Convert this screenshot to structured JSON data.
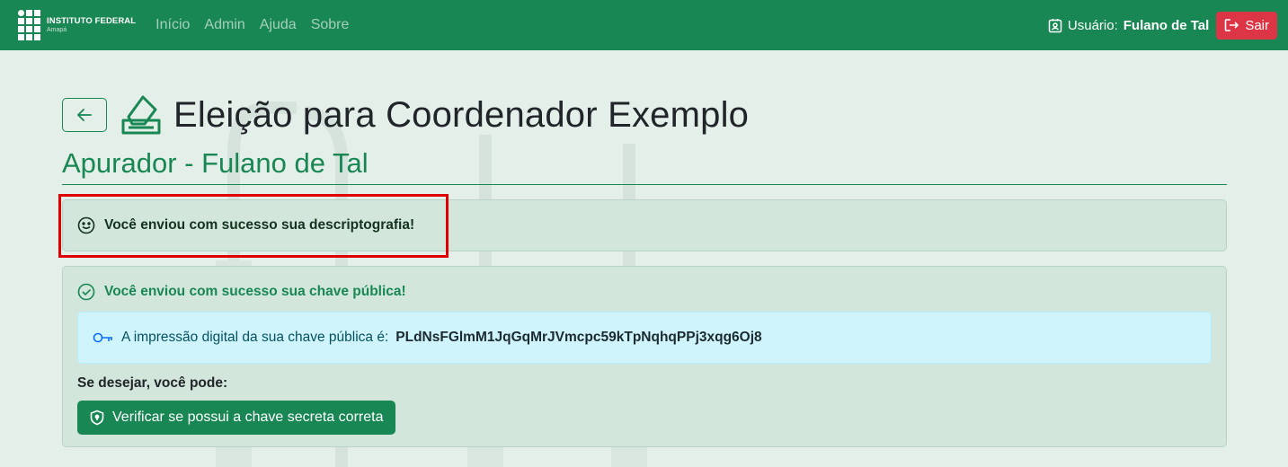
{
  "navbar": {
    "brand_name": "INSTITUTO FEDERAL",
    "brand_sub": "Amapá",
    "links": [
      {
        "label": "Início"
      },
      {
        "label": "Admin"
      },
      {
        "label": "Ajuda"
      },
      {
        "label": "Sobre"
      }
    ],
    "user_label": "Usuário:",
    "user_name": "Fulano de Tal",
    "logout_label": "Sair"
  },
  "page": {
    "title": "Eleição para Coordenador Exemplo",
    "subtitle": "Apurador - Fulano de Tal"
  },
  "decrypt_card": {
    "message": "Você enviou com sucesso sua descriptografia!",
    "icon": "smile-icon"
  },
  "pubkey_card": {
    "title": "Você enviou com sucesso sua chave pública!",
    "fingerprint_label": "A impressão digital da sua chave pública é:",
    "fingerprint_value": "PLdNsFGlmM1JqGqMrJVmcpc59kTpNqhqPPj3xqg6Oj8",
    "prompt": "Se desejar, você pode:",
    "verify_button": "Verificar se possui a chave secreta correta",
    "icons": [
      "check-circle-icon",
      "key-icon",
      "shield-icon"
    ]
  },
  "colors": {
    "primary": "#198754",
    "danger": "#dc3545",
    "background": "#e4efe9",
    "card": "#d2e6dc",
    "info": "#cff4fc",
    "highlight": "#e00000"
  }
}
